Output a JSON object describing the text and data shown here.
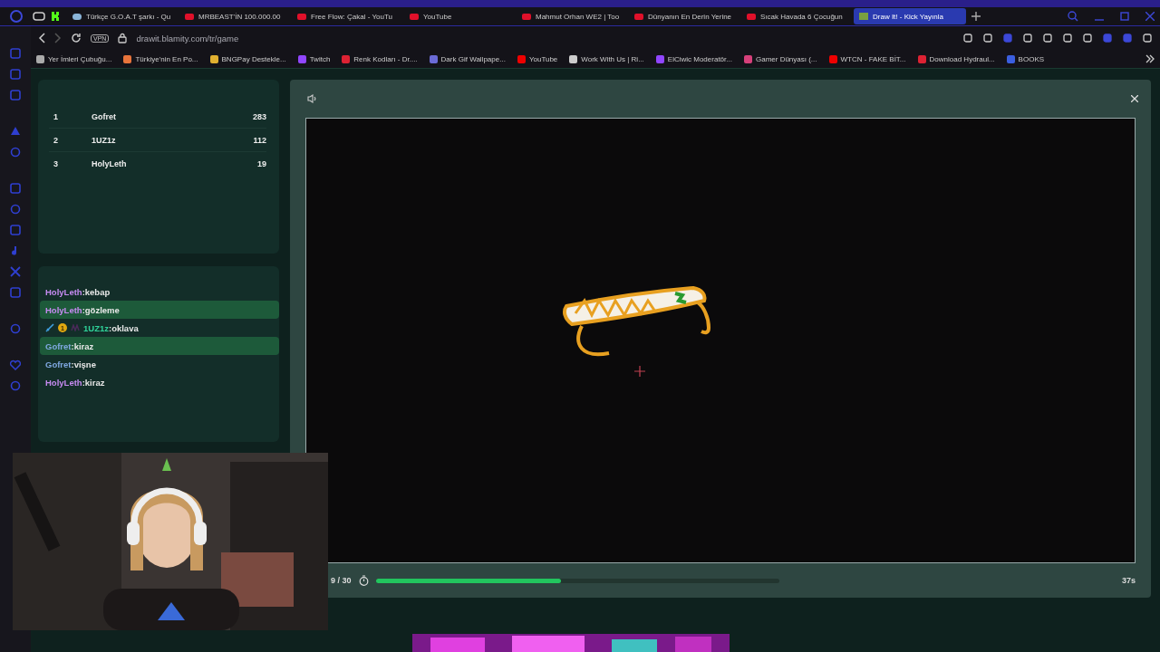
{
  "tabs": [
    {
      "kind": "weather",
      "label": "Türkçe G.O.A.T şarkı - Qu",
      "selected": false
    },
    {
      "kind": "youtube",
      "label": "MRBEAST'İN 100.000.00",
      "selected": false
    },
    {
      "kind": "youtube",
      "label": "Free Flow: Çakal - YouTu",
      "selected": false
    },
    {
      "kind": "youtube",
      "label": "YouTube",
      "selected": false
    },
    {
      "kind": "youtube",
      "label": "Mahmut Orhan WE2 | Too",
      "selected": false
    },
    {
      "kind": "youtube",
      "label": "Dünyanın En Derin Yerine",
      "selected": false
    },
    {
      "kind": "youtube",
      "label": "Sıcak Havada 6 Çocuğun",
      "selected": false
    },
    {
      "kind": "game",
      "label": "Draw It! - Kick Yayınla",
      "selected": true
    }
  ],
  "address_bar": {
    "vpn": "VPN",
    "url": "drawit.blamity.com/tr/game"
  },
  "bookmarks": [
    {
      "kind": "folder",
      "label": "Yer İmleri Çubuğu..."
    },
    {
      "kind": "orange",
      "label": "Türkiye'nin En Po..."
    },
    {
      "kind": "coin",
      "label": "BNGPay Destekle..."
    },
    {
      "kind": "twitch",
      "label": "Twitch"
    },
    {
      "kind": "red",
      "label": "Renk Kodları - Dr...."
    },
    {
      "kind": "globe",
      "label": "Dark Gif Wallpape..."
    },
    {
      "kind": "youtube",
      "label": "YouTube"
    },
    {
      "kind": "grey",
      "label": "Work With Us | Ri..."
    },
    {
      "kind": "twitch",
      "label": "ElCiwic Moderatör..."
    },
    {
      "kind": "instagram",
      "label": "Gamer Dünyası (..."
    },
    {
      "kind": "youtube",
      "label": "WTCN - FAKE BİT..."
    },
    {
      "kind": "red",
      "label": "Download Hydraul..."
    },
    {
      "kind": "blue",
      "label": "BOOKS"
    }
  ],
  "leaderboard": [
    {
      "rank": "1",
      "name": "Gofret",
      "score": "283"
    },
    {
      "rank": "2",
      "name": "1UZ1z",
      "score": "112"
    },
    {
      "rank": "3",
      "name": "HolyLeth",
      "score": "19"
    }
  ],
  "chat": [
    {
      "user": "HolyLeth",
      "color": "#c58af0",
      "message": ":kebap",
      "highlighted": false
    },
    {
      "user": "HolyLeth",
      "color": "#c58af0",
      "message": ":gözleme",
      "highlighted": true
    },
    {
      "user": "1UZ1z",
      "color": "#2fd39a",
      "message": ":oklava",
      "highlighted": false,
      "badge": "1"
    },
    {
      "user": "Gofret",
      "color": "#7fa8e0",
      "message": ":kiraz",
      "highlighted": true
    },
    {
      "user": "Gofret",
      "color": "#7fa8e0",
      "message": ":vişne",
      "highlighted": false
    },
    {
      "user": "HolyLeth",
      "color": "#c58af0",
      "message": ":kiraz",
      "highlighted": false
    }
  ],
  "game": {
    "round": "9 / 30",
    "level": 0.46,
    "time_left": "37s"
  }
}
